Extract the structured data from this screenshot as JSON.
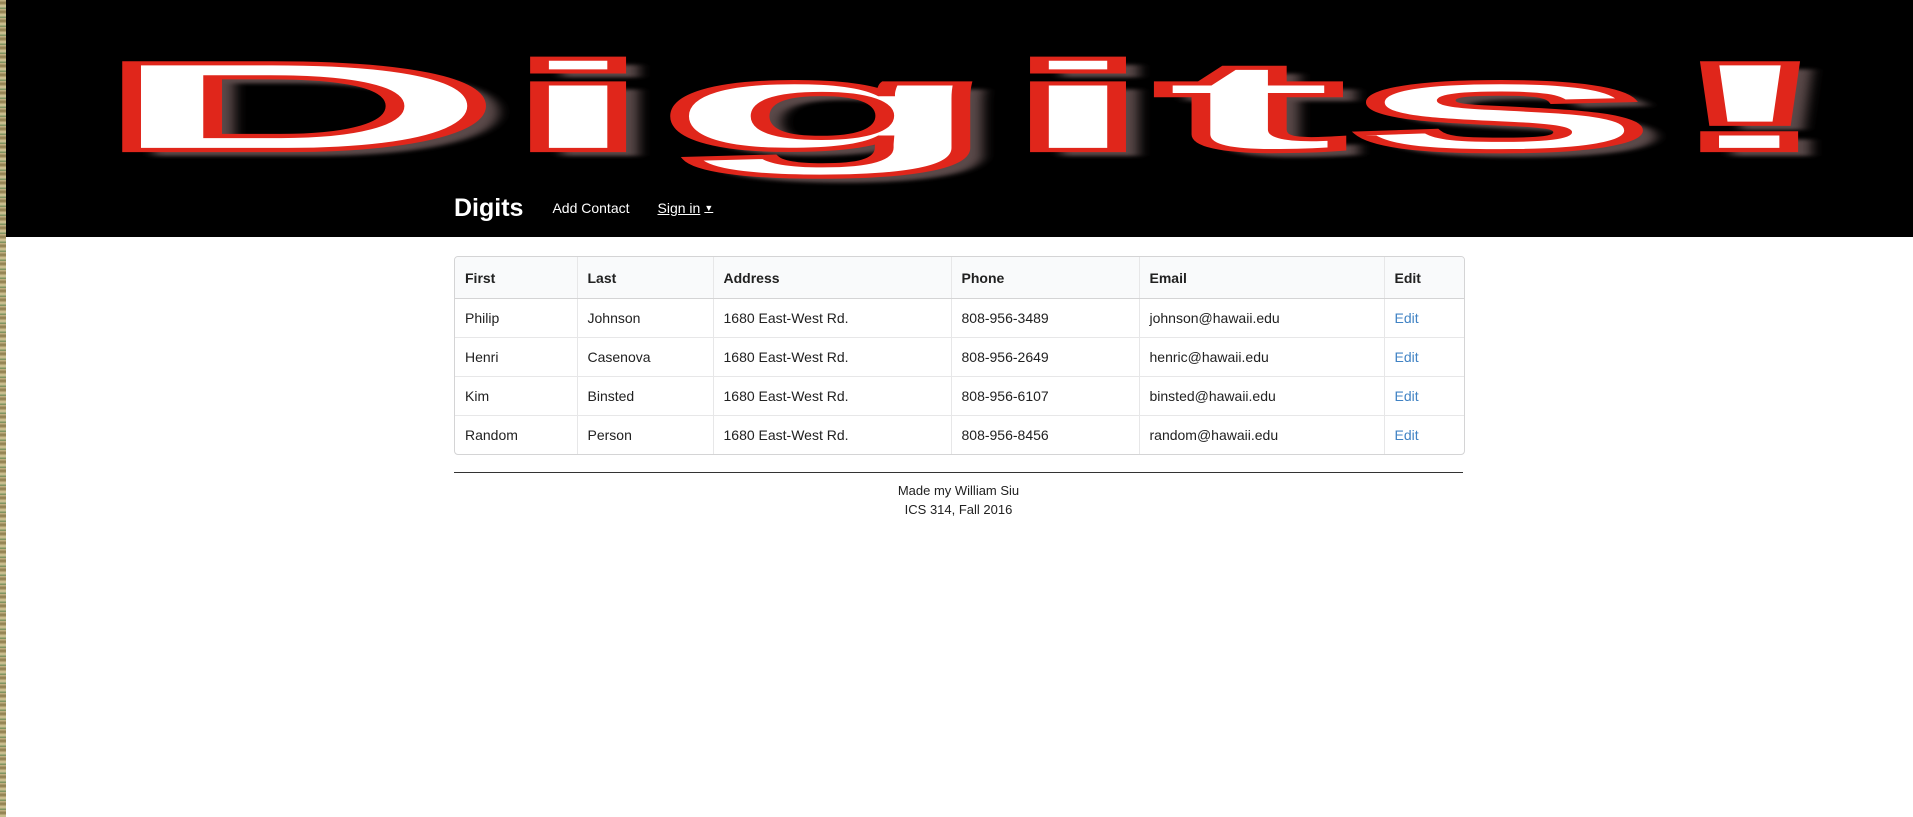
{
  "banner": {
    "logo_text": "Digits!"
  },
  "navbar": {
    "brand": "Digits",
    "add_contact": "Add Contact",
    "sign_in": "Sign in",
    "sign_in_caret": "▼"
  },
  "table": {
    "headers": [
      "First",
      "Last",
      "Address",
      "Phone",
      "Email",
      "Edit"
    ],
    "rows": [
      {
        "first": "Philip",
        "last": "Johnson",
        "address": "1680 East-West Rd.",
        "phone": "808-956-3489",
        "email": "johnson@hawaii.edu",
        "edit": "Edit"
      },
      {
        "first": "Henri",
        "last": "Casenova",
        "address": "1680 East-West Rd.",
        "phone": "808-956-2649",
        "email": "henric@hawaii.edu",
        "edit": "Edit"
      },
      {
        "first": "Kim",
        "last": "Binsted",
        "address": "1680 East-West Rd.",
        "phone": "808-956-6107",
        "email": "binsted@hawaii.edu",
        "edit": "Edit"
      },
      {
        "first": "Random",
        "last": "Person",
        "address": "1680 East-West Rd.",
        "phone": "808-956-8456",
        "email": "random@hawaii.edu",
        "edit": "Edit"
      }
    ]
  },
  "footer": {
    "line1": "Made my William Siu",
    "line2": "ICS 314, Fall 2016"
  },
  "colors": {
    "banner_bg": "#000000",
    "logo_fill": "#ffffff",
    "logo_stroke": "#e0261b",
    "link": "#4183c4"
  }
}
